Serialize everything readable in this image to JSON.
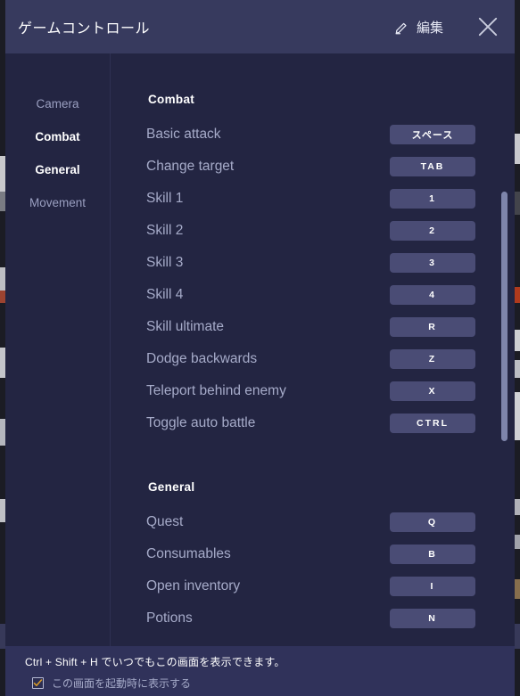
{
  "window": {
    "title": "ゲームコントロール",
    "edit_label": "編集",
    "edit_icon": "pencil-icon",
    "close_icon": "close-icon"
  },
  "sidebar": {
    "items": [
      {
        "label": "Camera",
        "active": false
      },
      {
        "label": "Combat",
        "active": true
      },
      {
        "label": "General",
        "active": true
      },
      {
        "label": "Movement",
        "active": false
      }
    ]
  },
  "sections": [
    {
      "title": "Combat",
      "rows": [
        {
          "label": "Basic attack",
          "key": "スペース",
          "jp": true
        },
        {
          "label": "Change target",
          "key": "TAB",
          "jp": false
        },
        {
          "label": "Skill 1",
          "key": "1",
          "jp": false
        },
        {
          "label": "Skill 2",
          "key": "2",
          "jp": false
        },
        {
          "label": "Skill 3",
          "key": "3",
          "jp": false
        },
        {
          "label": "Skill 4",
          "key": "4",
          "jp": false
        },
        {
          "label": "Skill ultimate",
          "key": "R",
          "jp": false
        },
        {
          "label": "Dodge backwards",
          "key": "Z",
          "jp": false
        },
        {
          "label": "Teleport behind enemy",
          "key": "X",
          "jp": false
        },
        {
          "label": "Toggle auto battle",
          "key": "CTRL",
          "jp": false
        }
      ]
    },
    {
      "title": "General",
      "rows": [
        {
          "label": "Quest",
          "key": "Q",
          "jp": false
        },
        {
          "label": "Consumables",
          "key": "B",
          "jp": false
        },
        {
          "label": "Open inventory",
          "key": "I",
          "jp": false
        },
        {
          "label": "Potions",
          "key": "N",
          "jp": false
        }
      ]
    }
  ],
  "footer": {
    "hint": "Ctrl + Shift + H でいつでもこの画面を表示できます。",
    "checkbox_label": "この画面を起動時に表示する",
    "checkbox_checked": true,
    "checkbox_icon": "checkmark-icon"
  },
  "scrollbar": {
    "name": "vertical-scrollbar"
  },
  "colors": {
    "modal_bg": "#232542",
    "titlebar_bg": "#373a5e",
    "footer_bg": "#30325a",
    "key_chip_bg": "#4a4c75",
    "label_text": "#a6abc9",
    "active_text": "#ffffff",
    "scrollbar_thumb": "#7e85ab",
    "check_accent": "#d99b28"
  }
}
